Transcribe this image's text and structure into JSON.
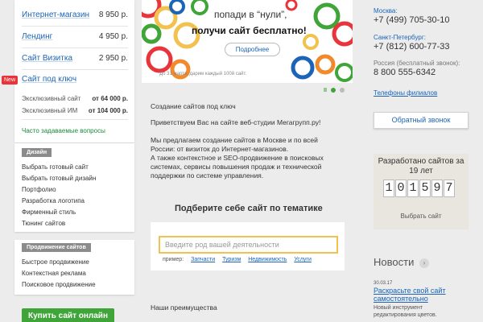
{
  "products": [
    {
      "name": "Интернет-магазин",
      "price": "8 950 р."
    },
    {
      "name": "Лендинг",
      "price": "4 950 р."
    },
    {
      "name": "Сайт Визитка",
      "price": "2 950 р."
    },
    {
      "name": "Сайт под ключ",
      "price": ""
    }
  ],
  "new_badge": "New",
  "exclusive": [
    {
      "name": "Эксклюзивный сайт",
      "price": "от 64 000 р."
    },
    {
      "name": "Эксклюзивный ИМ",
      "price": "от 104 000 р."
    }
  ],
  "faq_link": "Часто задаваемые вопросы",
  "design": {
    "header": "Дизайн",
    "items": [
      "Выбрать готовый сайт",
      "Выбрать готовый дизайн",
      "Портфолио",
      "Разработка логотипа",
      "Фирменный стиль",
      "Тюнинг сайтов"
    ]
  },
  "promo": {
    "header": "Продвижение сайтов",
    "items": [
      "Быстрое продвижение",
      "Контекстная реклама",
      "Поисковое продвижение"
    ]
  },
  "buy_button": "Купить сайт онлайн",
  "banner": {
    "line1": "попади в “нули”,",
    "line2": "получи сайт бесплатно!",
    "button": "Подробнее",
    "footnote": "До 31 марта, дарим каждый 100й сайт."
  },
  "slider": {
    "pause": "II"
  },
  "content": {
    "title": "Создание сайтов под ключ",
    "welcome": "Приветствуем Вас на сайте веб-студии Мегагрупп.ру!",
    "p1": "Мы предлагаем создание сайтов в Москве и по всей России: от визиток до Интернет-магазинов.",
    "p2": "А также контекстное и SEO-продвижение в поисковых системах, сервисы повышения продаж и технической поддержки по системе управления.",
    "themes_heading": "Подберите себе сайт по тематике",
    "search_placeholder": "Введите род вашей деятельности",
    "examples_label": "пример:",
    "examples": [
      "Запчасти",
      "Туризм",
      "Недвижимость",
      "Услуги"
    ],
    "advantages": "Наши преимущества"
  },
  "contacts": {
    "moscow_label": "Москва:",
    "moscow_phone": "+7 (499) 705-30-10",
    "spb_label": "Санкт-Петербург:",
    "spb_phone": "+7 (812) 600-77-33",
    "free_label": "Россия (бесплатный звонок):",
    "free_phone": "8 800 555-6342",
    "branches": "Телефоны филиалов"
  },
  "callback_button": "Обратный звонок",
  "counter": {
    "title": "Разработано сайтов за 19 лет",
    "digits": [
      "1",
      "0",
      "1",
      "5",
      "9",
      "7"
    ],
    "choose": "Выбрать сайт"
  },
  "news": {
    "title": "Новости",
    "date": "30.03.17",
    "headline": "Раскрасьте свой сайт самостоятельно",
    "desc": "Новый инструмент редактирования цветов."
  },
  "colors": {
    "accent_green": "#3fa538",
    "link_blue": "#1b64b8",
    "badge_red": "#e8343a",
    "input_border": "#f2c14e"
  }
}
